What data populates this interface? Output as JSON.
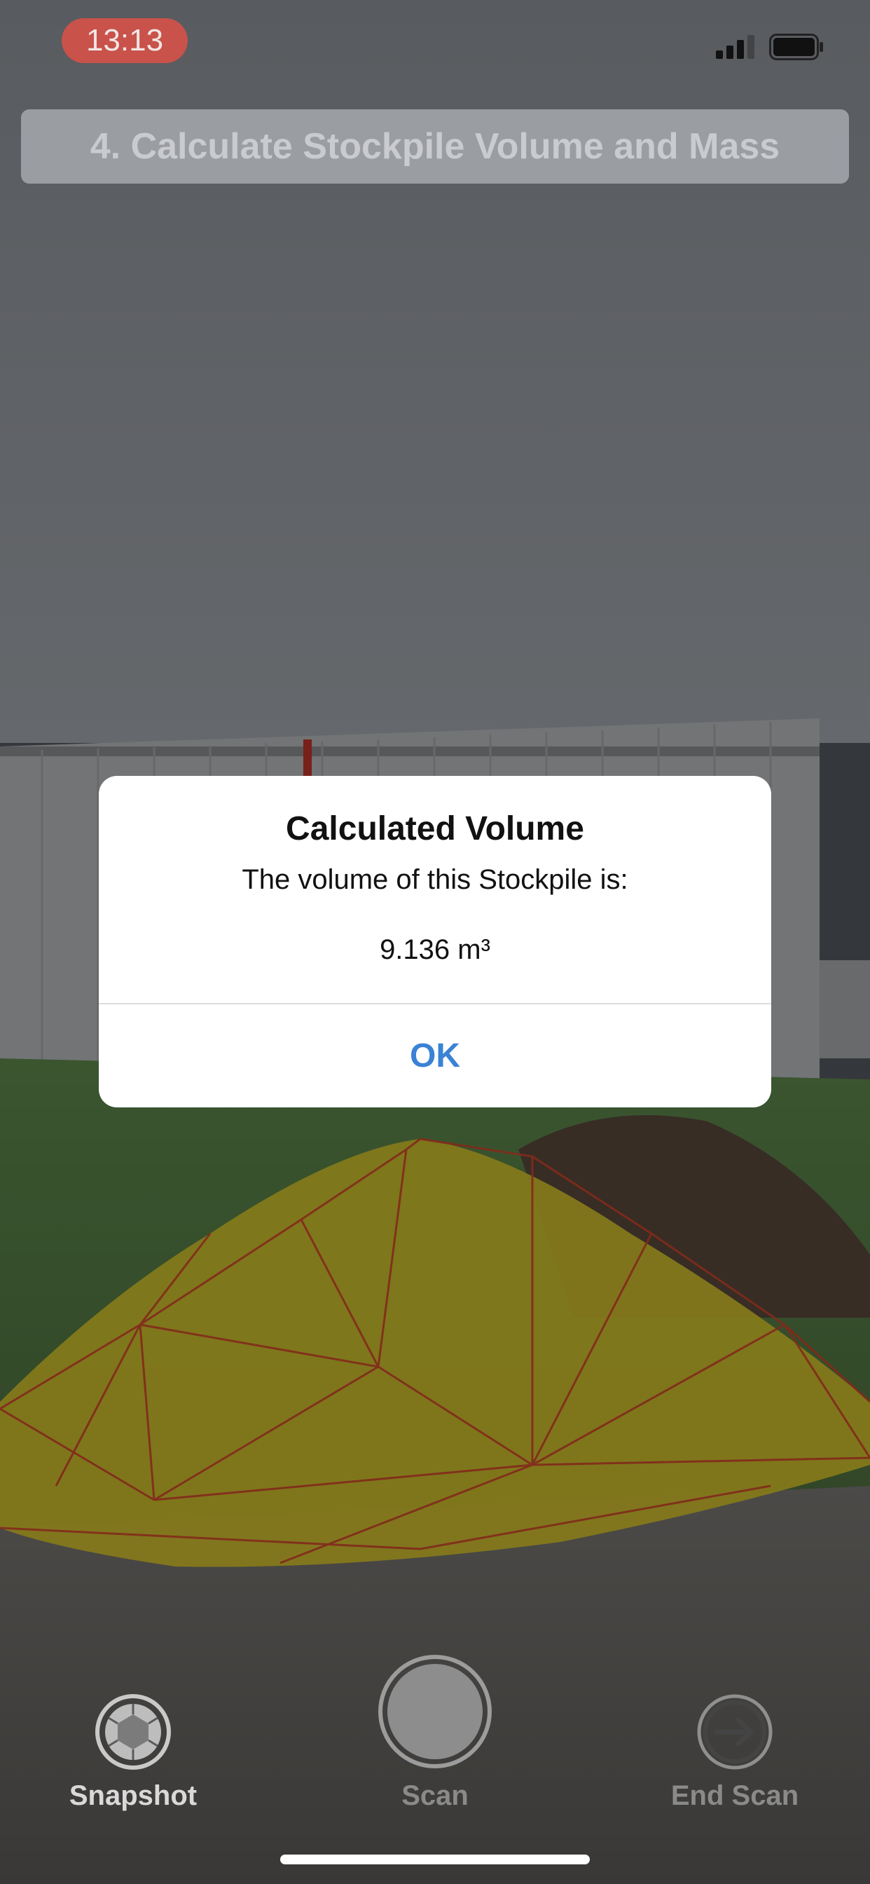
{
  "status_bar": {
    "time": "13:13",
    "icons": [
      "cellular-signal-icon",
      "battery-icon"
    ]
  },
  "step_banner": {
    "title": "4. Calculate Stockpile Volume and Mass"
  },
  "alert": {
    "title": "Calculated Volume",
    "message": "The volume of this Stockpile is:",
    "value": "9.136 m³",
    "ok_label": "OK"
  },
  "toolbar": {
    "snapshot_label": "Snapshot",
    "scan_label": "Scan",
    "end_scan_label": "End Scan",
    "snapshot_icon": "camera-aperture-icon",
    "scan_icon": "shutter-circle-icon",
    "end_scan_icon": "arrow-right-circle-icon"
  },
  "colors": {
    "time_pill": "#c9524a",
    "alert_button": "#3a82d6",
    "mesh_fill": "#d8c62a",
    "mesh_edges": "#d2452c"
  }
}
